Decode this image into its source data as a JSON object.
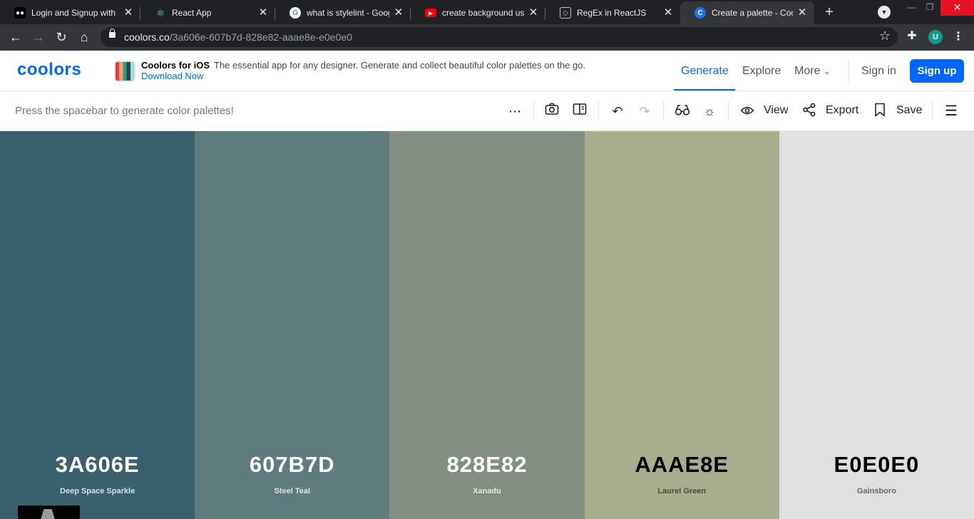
{
  "browser": {
    "tabs": [
      {
        "title": "Login and Signup with",
        "favicon": "medium-icon"
      },
      {
        "title": "React App",
        "favicon": "react-icon"
      },
      {
        "title": "what is stylelint - Googl",
        "favicon": "google-icon"
      },
      {
        "title": "create background usin",
        "favicon": "youtube-icon"
      },
      {
        "title": "RegEx in ReactJS",
        "favicon": "site-icon"
      },
      {
        "title": "Create a palette - Coolo",
        "favicon": "coolors-icon",
        "active": true
      }
    ],
    "url_host": "coolors.co",
    "url_path": "/3a606e-607b7d-828e82-aaae8e-e0e0e0",
    "profile_initial": "U"
  },
  "header": {
    "logo": "coolors",
    "promo_title": "Coolors for iOS",
    "promo_desc": "The essential app for any designer. Generate and collect beautiful color palettes on the go.",
    "promo_link": "Download Now",
    "nav": [
      "Generate",
      "Explore",
      "More"
    ],
    "sign_in": "Sign in",
    "sign_up": "Sign up"
  },
  "toolbar": {
    "hint": "Press the spacebar to generate color palettes!",
    "view_label": "View",
    "export_label": "Export",
    "save_label": "Save"
  },
  "palette": [
    {
      "hex": "3A606E",
      "name": "Deep Space Sparkle",
      "color": "#3A606E",
      "text_color": "#ffffff",
      "name_color": "#d9e1e4"
    },
    {
      "hex": "607B7D",
      "name": "Steel Teal",
      "color": "#607B7D",
      "text_color": "#ffffff",
      "name_color": "#dde3e4"
    },
    {
      "hex": "828E82",
      "name": "Xanadu",
      "color": "#828E82",
      "text_color": "#ffffff",
      "name_color": "#e4e8e4"
    },
    {
      "hex": "AAAE8E",
      "name": "Laurel Green",
      "color": "#AAAE8E",
      "text_color": "#000000",
      "name_color": "#4a4c3e"
    },
    {
      "hex": "E0E0E0",
      "name": "Gainsboro",
      "color": "#E0E0E0",
      "text_color": "#000000",
      "name_color": "#666666"
    }
  ],
  "colors": {
    "accent": "#0066ff",
    "chrome_dark": "#202124",
    "chrome_mid": "#35363a"
  }
}
